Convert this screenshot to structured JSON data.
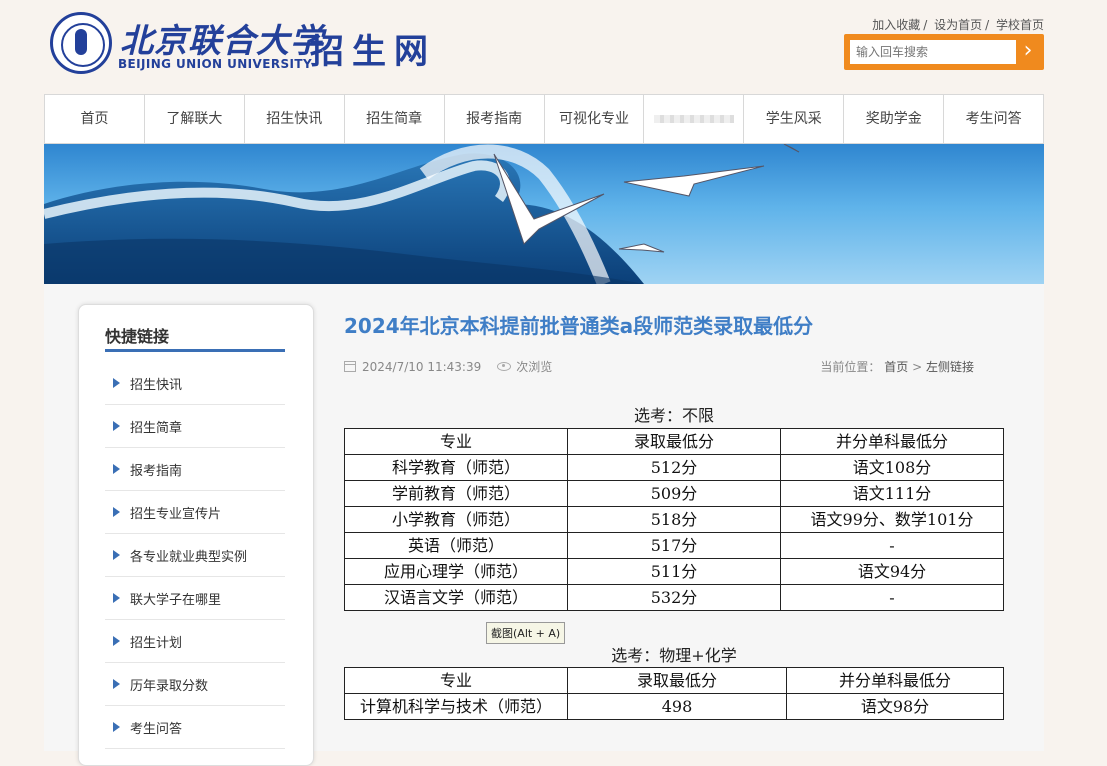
{
  "header": {
    "logo_cn": "北京联合大学",
    "logo_en": "BEIJING UNION UNIVERSITY",
    "site_name": "招生网",
    "top_links": [
      "加入收藏",
      "设为首页",
      "学校首页"
    ],
    "search_placeholder": "输入回车搜索"
  },
  "nav": {
    "items": [
      "首页",
      "了解联大",
      "招生快讯",
      "招生简章",
      "报考指南",
      "可视化专业",
      "",
      "学生风采",
      "奖助学金",
      "考生问答"
    ]
  },
  "sidebar": {
    "title": "快捷链接",
    "items": [
      "招生快讯",
      "招生简章",
      "报考指南",
      "招生专业宣传片",
      "各专业就业典型实例",
      "联大学子在哪里",
      "招生计划",
      "历年录取分数",
      "考生问答"
    ]
  },
  "article": {
    "title": "2024年北京本科提前批普通类a段师范类录取最低分",
    "date": "2024/7/10 11:43:39",
    "views": "次浏览",
    "breadcrumb_label": "当前位置：",
    "breadcrumb_home": "首页",
    "breadcrumb_sep": ">",
    "breadcrumb_current": "左侧链接"
  },
  "table1": {
    "caption": "选考：不限",
    "headers": [
      "专业",
      "录取最低分",
      "并分单科最低分"
    ],
    "rows": [
      [
        "科学教育（师范）",
        "512分",
        "语文108分"
      ],
      [
        "学前教育（师范）",
        "509分",
        "语文111分"
      ],
      [
        "小学教育（师范）",
        "518分",
        "语文99分、数学101分"
      ],
      [
        "英语（师范）",
        "517分",
        "-"
      ],
      [
        "应用心理学（师范）",
        "511分",
        "语文94分"
      ],
      [
        "汉语言文学（师范）",
        "532分",
        "-"
      ]
    ]
  },
  "table2": {
    "caption": "选考：物理+化学",
    "headers": [
      "专业",
      "录取最低分",
      "并分单科最低分"
    ],
    "rows": [
      [
        "计算机科学与技术（师范）",
        "498",
        "语文98分"
      ]
    ]
  },
  "tooltip": "截图(Alt + A)"
}
